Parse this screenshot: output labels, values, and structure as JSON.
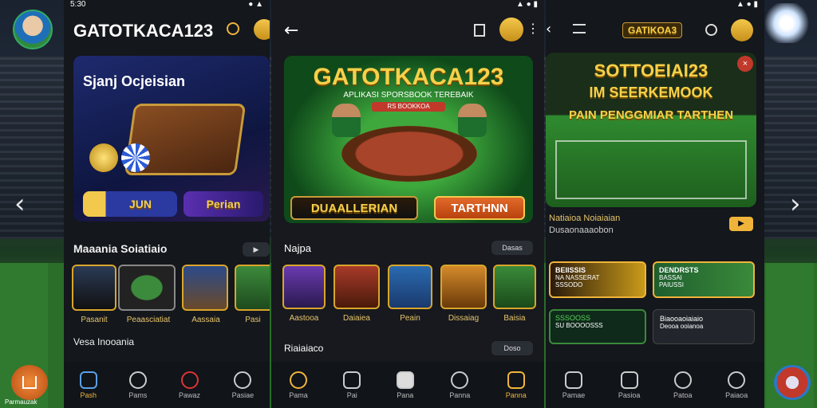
{
  "left_overlay": {
    "home_label": "Parmauzak"
  },
  "screen1": {
    "status_time": "5:30",
    "title": "GATOTKACA123",
    "hero_title": "Sjanj Ocjeisian",
    "hero_btn_left": "JUN",
    "hero_btn_right": "Perian",
    "section_title": "Maaania Soiatiaio",
    "games": [
      "Pasanit",
      "Peaasciatiat",
      "Aassaia",
      "Pasi"
    ],
    "section2_title": "Vesa Inooania",
    "nav": [
      "Pash",
      "Pams",
      "Pawaz",
      "Pasiae"
    ]
  },
  "screen2": {
    "hero_title": "GATOTKACA123",
    "hero_subtitle": "APLIKASI SPORSBOOK TEREBAIK",
    "hero_tag": "RS BOOKKOA",
    "btn_left": "DUAALLERIAN",
    "btn_right": "TARTHNN",
    "section_title": "Najpa",
    "section_chip": "Dasas",
    "games": [
      "Aastooa",
      "Daiaiea",
      "Peain",
      "Dissaiag",
      "Baisia"
    ],
    "section2_title": "Riaiaiaco",
    "section2_chip": "Doso",
    "nav": [
      "Pama",
      "Pai",
      "Pana",
      "Panna",
      "Panna"
    ]
  },
  "screen3": {
    "logo": "GATIKOA3",
    "hero_line1": "SOTTOEIAI23",
    "hero_line2": "IM SEERKEMOOK",
    "hero_line3": "PAIN PENGGMIAR TARTHEN",
    "info_title": "Natiaioa Noiaiaian",
    "info_sub": "Dusaonaaaobon",
    "cards": [
      {
        "title": "BEIISSIS",
        "lines": [
          "NA NASSERAT",
          "SSSODO"
        ]
      },
      {
        "title": "DENDRSTS",
        "lines": [
          "BASSAI",
          "PAIUSSI"
        ]
      },
      {
        "title": "SSSOOSS",
        "lines": [
          "SU BOOOOSSS"
        ]
      },
      {
        "title": "Biaooaoiaiaio",
        "lines": [
          "Deooa ooianoa"
        ]
      }
    ],
    "nav": [
      "Pamae",
      "Pasioa",
      "Patoa",
      "Paiaoa"
    ]
  },
  "colors": {
    "accent": "#f0b43a",
    "gold": "#e6c56b",
    "screen_bg": "#14171c"
  }
}
